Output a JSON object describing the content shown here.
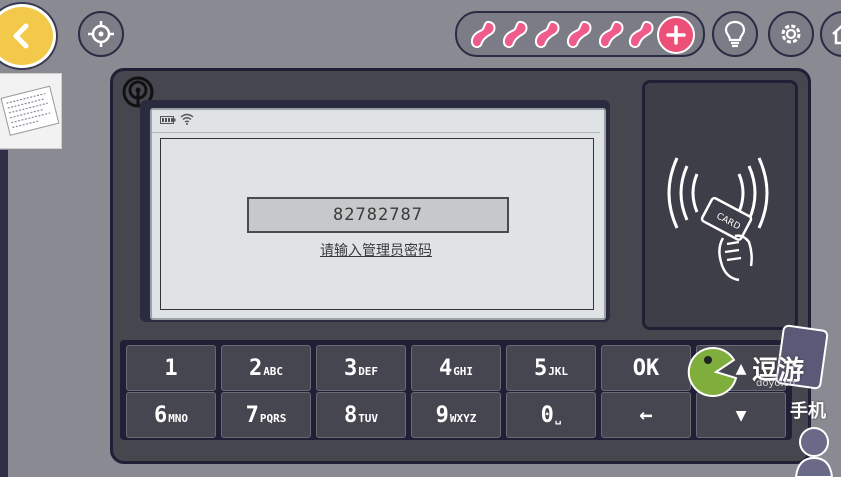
{
  "screen": {
    "code_value": "82782787",
    "prompt": "请输入管理员密码"
  },
  "reader": {
    "card_label": "CARD"
  },
  "keypad": {
    "keys": [
      {
        "digit": "1",
        "letters": ""
      },
      {
        "digit": "2",
        "letters": "ABC"
      },
      {
        "digit": "3",
        "letters": "DEF"
      },
      {
        "digit": "4",
        "letters": "GHI"
      },
      {
        "digit": "5",
        "letters": "JKL"
      },
      {
        "digit": "OK",
        "letters": ""
      },
      {
        "digit": "6",
        "letters": "MNO"
      },
      {
        "digit": "7",
        "letters": "PQRS"
      },
      {
        "digit": "8",
        "letters": "TUV"
      },
      {
        "digit": "9",
        "letters": "WXYZ"
      },
      {
        "digit": "0",
        "letters": "␣"
      },
      {
        "digit": "←",
        "letters": ""
      }
    ],
    "up_arrow": "▲",
    "down_arrow": "▼"
  },
  "toolbar": {
    "bean_count": 6,
    "icons": [
      "back-icon",
      "crosshair-icon",
      "bean-icon",
      "plus-icon",
      "lightbulb-icon",
      "gear-icon",
      "home-icon"
    ]
  },
  "watermark": {
    "line1": "逗游",
    "line2": "手机",
    "subtitle": "doyo.cn"
  },
  "colors": {
    "back_button": "#f3c94a",
    "bean": "#ef5c8b",
    "plus_button": "#ec4f78",
    "device_border": "#1f1f36"
  }
}
